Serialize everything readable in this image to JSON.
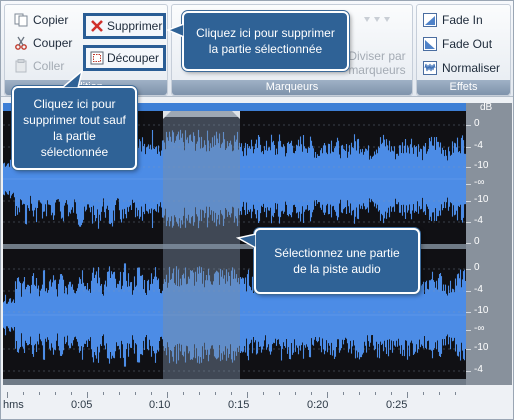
{
  "toolbar": {
    "edit_group": {
      "label": "Edition",
      "copy": "Copier",
      "cut": "Couper",
      "paste": "Coller",
      "delete": "Supprimer",
      "trim": "Découper"
    },
    "markers_group": {
      "label": "Marqueurs",
      "split_by_markers": "Diviser par\nmarqueurs"
    },
    "effects_group": {
      "label": "Effets",
      "fade_in": "Fade In",
      "fade_out": "Fade Out",
      "normalize": "Normaliser"
    }
  },
  "callouts": {
    "delete_tip": "Cliquez ici pour supprimer la partie sélectionnée",
    "trim_tip": "Cliquez ici pour supprimer tout sauf la partie sélectionnée",
    "select_tip": "Sélectionnez une partie de la piste audio"
  },
  "db_scale": {
    "unit": "dB",
    "track1": [
      "0",
      "-4",
      "-10",
      "-∞",
      "-10",
      "-4",
      "0"
    ],
    "track2": [
      "0",
      "-4",
      "-10",
      "-∞",
      "-10",
      "-4"
    ]
  },
  "timeline": {
    "unit": "hms",
    "labels": [
      "0:05",
      "0:10",
      "0:15",
      "0:20",
      "0:25"
    ]
  },
  "selection": {
    "start": "0:10",
    "end": "0:15"
  },
  "colors": {
    "waveform": "#4c8ce6",
    "selection": "#7c8ea3",
    "background": "#101014",
    "callout": "#2f6296",
    "highlight": "#2a5d95"
  }
}
